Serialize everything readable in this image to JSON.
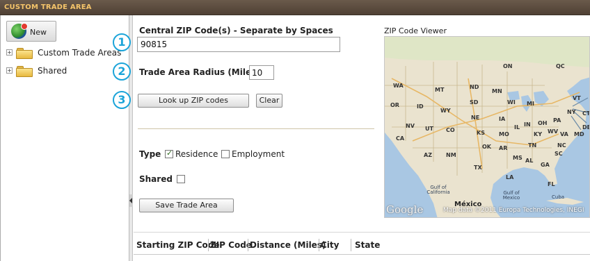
{
  "window": {
    "title": "CUSTOM TRADE AREA"
  },
  "sidebar": {
    "new_label": "New",
    "tree": [
      {
        "label": "Custom Trade Areas",
        "expander": "+"
      },
      {
        "label": "Shared",
        "expander": "+"
      }
    ]
  },
  "steps": [
    "1",
    "2",
    "3"
  ],
  "form": {
    "zip_label": "Central ZIP Code(s) - Separate by Spaces",
    "zip_value": "90815",
    "radius_label": "Trade Area Radius (Miles)",
    "radius_value": "10",
    "lookup_label": "Look up ZIP codes",
    "clear_label": "Clear",
    "type_label": "Type",
    "residence_label": "Residence",
    "residence_checked": true,
    "employment_label": "Employment",
    "employment_checked": false,
    "shared_label": "Shared",
    "shared_checked": false,
    "save_label": "Save Trade Area"
  },
  "map": {
    "title": "ZIP Code Viewer",
    "state_labels": [
      "ON",
      "QC",
      "WA",
      "MT",
      "ND",
      "MN",
      "OR",
      "ID",
      "SD",
      "WI",
      "MI",
      "VT",
      "WY",
      "NY",
      "NE",
      "IA",
      "PA",
      "CT",
      "IL",
      "IN",
      "OH",
      "NV",
      "UT",
      "CO",
      "KS",
      "MO",
      "KY",
      "WV",
      "VA",
      "DE",
      "CA",
      "OK",
      "AR",
      "TN",
      "NC",
      "MD",
      "AZ",
      "NM",
      "MS",
      "AL",
      "SC",
      "TX",
      "GA",
      "LA",
      "FL"
    ],
    "water_labels": [
      "Gulf of California",
      "Gulf of Mexico"
    ],
    "country_labels": [
      "México",
      "Cuba"
    ],
    "logo": "Google",
    "attribution": "Map data ©2011 Europa Technologies, INEGI"
  },
  "results_table": {
    "columns": [
      "Starting ZIP Code",
      "ZIP Code",
      "Distance (Miles)",
      "City",
      "State"
    ]
  },
  "colors": {
    "accent": "#1ba4d9",
    "title_text": "#f4c46a",
    "titlebar": "#5a4a3c"
  }
}
